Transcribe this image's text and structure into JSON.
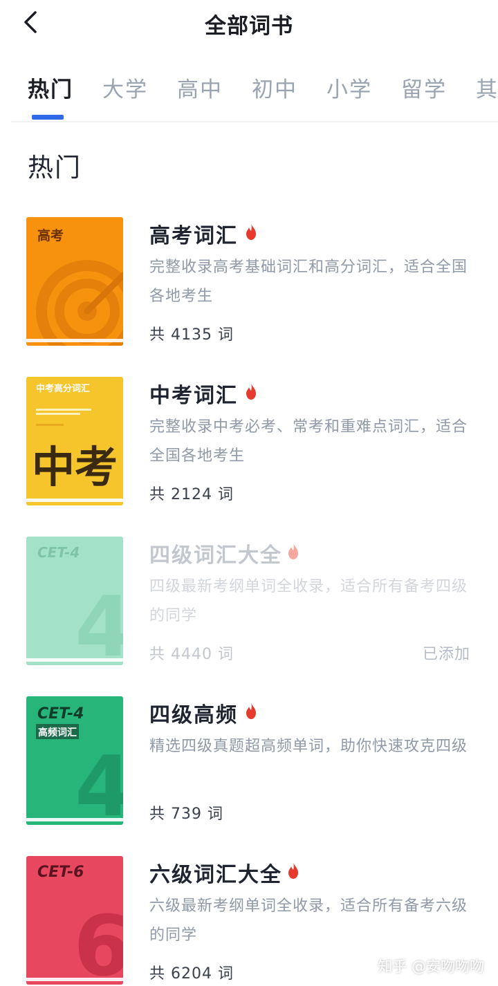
{
  "header": {
    "title": "全部词书",
    "back_icon": "chevron-left-icon"
  },
  "tabs": [
    {
      "label": "热门",
      "active": true
    },
    {
      "label": "大学",
      "active": false
    },
    {
      "label": "高中",
      "active": false
    },
    {
      "label": "初中",
      "active": false
    },
    {
      "label": "小学",
      "active": false
    },
    {
      "label": "留学",
      "active": false
    },
    {
      "label": "其他",
      "active": false
    }
  ],
  "section": {
    "title": "热门"
  },
  "books": [
    {
      "title": "高考词汇",
      "description": "完整收录高考基础词汇和高分词汇，适合全国各地考生",
      "count": "共 4135 词",
      "cover": {
        "label": "高考",
        "color": "#f7920f"
      },
      "hot": true,
      "added_label": ""
    },
    {
      "title": "中考词汇",
      "description": "完整收录中考必考、常考和重难点词汇，适合全国各地考生",
      "count": "共 2124 词",
      "cover": {
        "label": "中考高分词汇",
        "big_text": "中考",
        "color": "#f6c52b"
      },
      "hot": true,
      "added_label": ""
    },
    {
      "title": "四级词汇大全",
      "description": "四级最新考纲单词全收录，适合所有备考四级的同学",
      "count": "共 4440 词",
      "cover": {
        "label": "CET-4",
        "big_text": "4",
        "color": "#a3e2c9"
      },
      "hot": true,
      "added_label": "已添加"
    },
    {
      "title": "四级高频",
      "description": "精选四级真题超高频单词，助你快速攻克四级",
      "count": "共 739 词",
      "cover": {
        "label": "CET-4",
        "sub_label": "高频词汇",
        "big_text": "4",
        "color": "#27b57a"
      },
      "hot": true,
      "added_label": ""
    },
    {
      "title": "六级词汇大全",
      "description": "六级最新考纲单词全收录，适合所有备考六级的同学",
      "count": "共 6204 词",
      "cover": {
        "label": "CET-6",
        "big_text": "6",
        "color": "#e8485f"
      },
      "hot": true,
      "added_label": ""
    }
  ],
  "watermark": "知乎 @安吻吻吻",
  "colors": {
    "accent": "#2f6be6",
    "hot_icon": "#e63a2e"
  }
}
